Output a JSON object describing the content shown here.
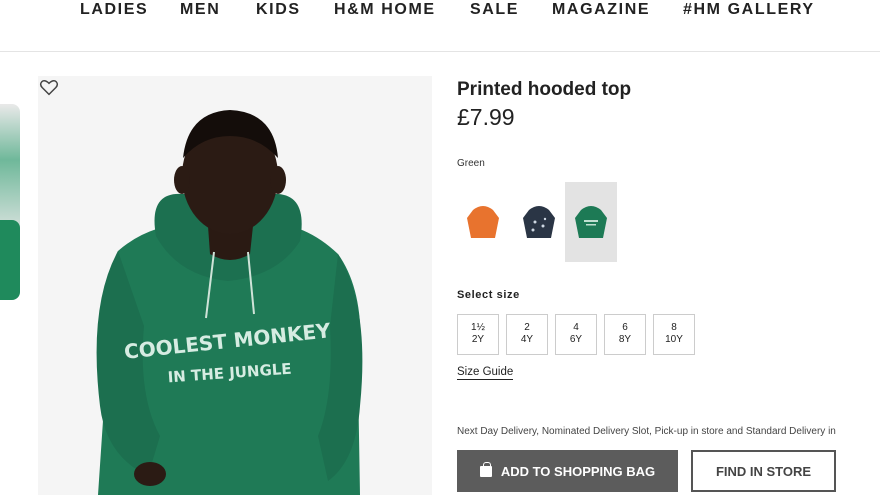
{
  "nav": {
    "items": [
      {
        "label": "LADIES"
      },
      {
        "label": "MEN"
      },
      {
        "label": "KIDS"
      },
      {
        "label": "H&M HOME"
      },
      {
        "label": "SALE"
      },
      {
        "label": "MAGAZINE"
      },
      {
        "label": "#HM GALLERY"
      }
    ]
  },
  "product": {
    "title": "Printed hooded top",
    "price": "£7.99",
    "print_text_line1": "COOLEST MONKEY",
    "print_text_line2": "IN THE JUNGLE",
    "selected_color": "Green",
    "swatches": [
      {
        "color": "#e8732e"
      },
      {
        "color": "#2a3545"
      },
      {
        "color": "#1d7a55"
      }
    ],
    "size_label": "Select size",
    "sizes": [
      {
        "line1": "1½",
        "line2": "2Y"
      },
      {
        "line1": "2",
        "line2": "4Y"
      },
      {
        "line1": "4",
        "line2": "6Y"
      },
      {
        "line1": "6",
        "line2": "8Y"
      },
      {
        "line1": "8",
        "line2": "10Y"
      }
    ],
    "size_guide": "Size Guide",
    "delivery_text": "Next Day Delivery, Nominated Delivery Slot, Pick-up in store and Standard Delivery in",
    "add_to_bag": "ADD TO SHOPPING BAG",
    "find_in_store": "FIND IN STORE"
  },
  "icons": {
    "favorite": "heart-outline-icon",
    "bag": "shopping-bag-icon"
  },
  "colors": {
    "hoodie_green": "#1f7a56",
    "button_dark": "#5c5c5c"
  }
}
